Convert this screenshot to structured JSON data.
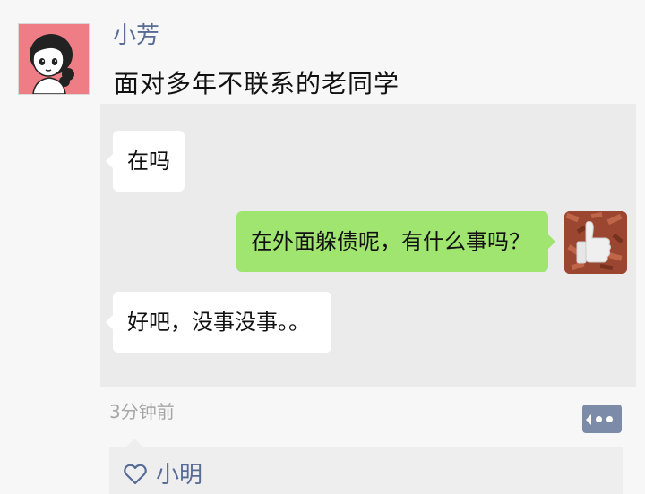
{
  "post": {
    "author": "小芳",
    "text": "面对多年不联系的老同学",
    "time": "3分钟前"
  },
  "chat": {
    "messages": [
      {
        "side": "incoming",
        "text": "在吗"
      },
      {
        "side": "outgoing",
        "text": "在外面躲债呢，有什么事吗？"
      },
      {
        "side": "incoming",
        "text": "好吧，没事没事。。"
      }
    ]
  },
  "likes": {
    "names": "小明"
  },
  "icons": {
    "comment_button": "more-dots-icon",
    "like": "heart-icon"
  },
  "colors": {
    "name_blue": "#576b95",
    "outgoing_bubble": "#9fe570",
    "incoming_bubble": "#ffffff",
    "avatar_bg": "#ee7d86",
    "comment_button": "#7c8ca8"
  }
}
